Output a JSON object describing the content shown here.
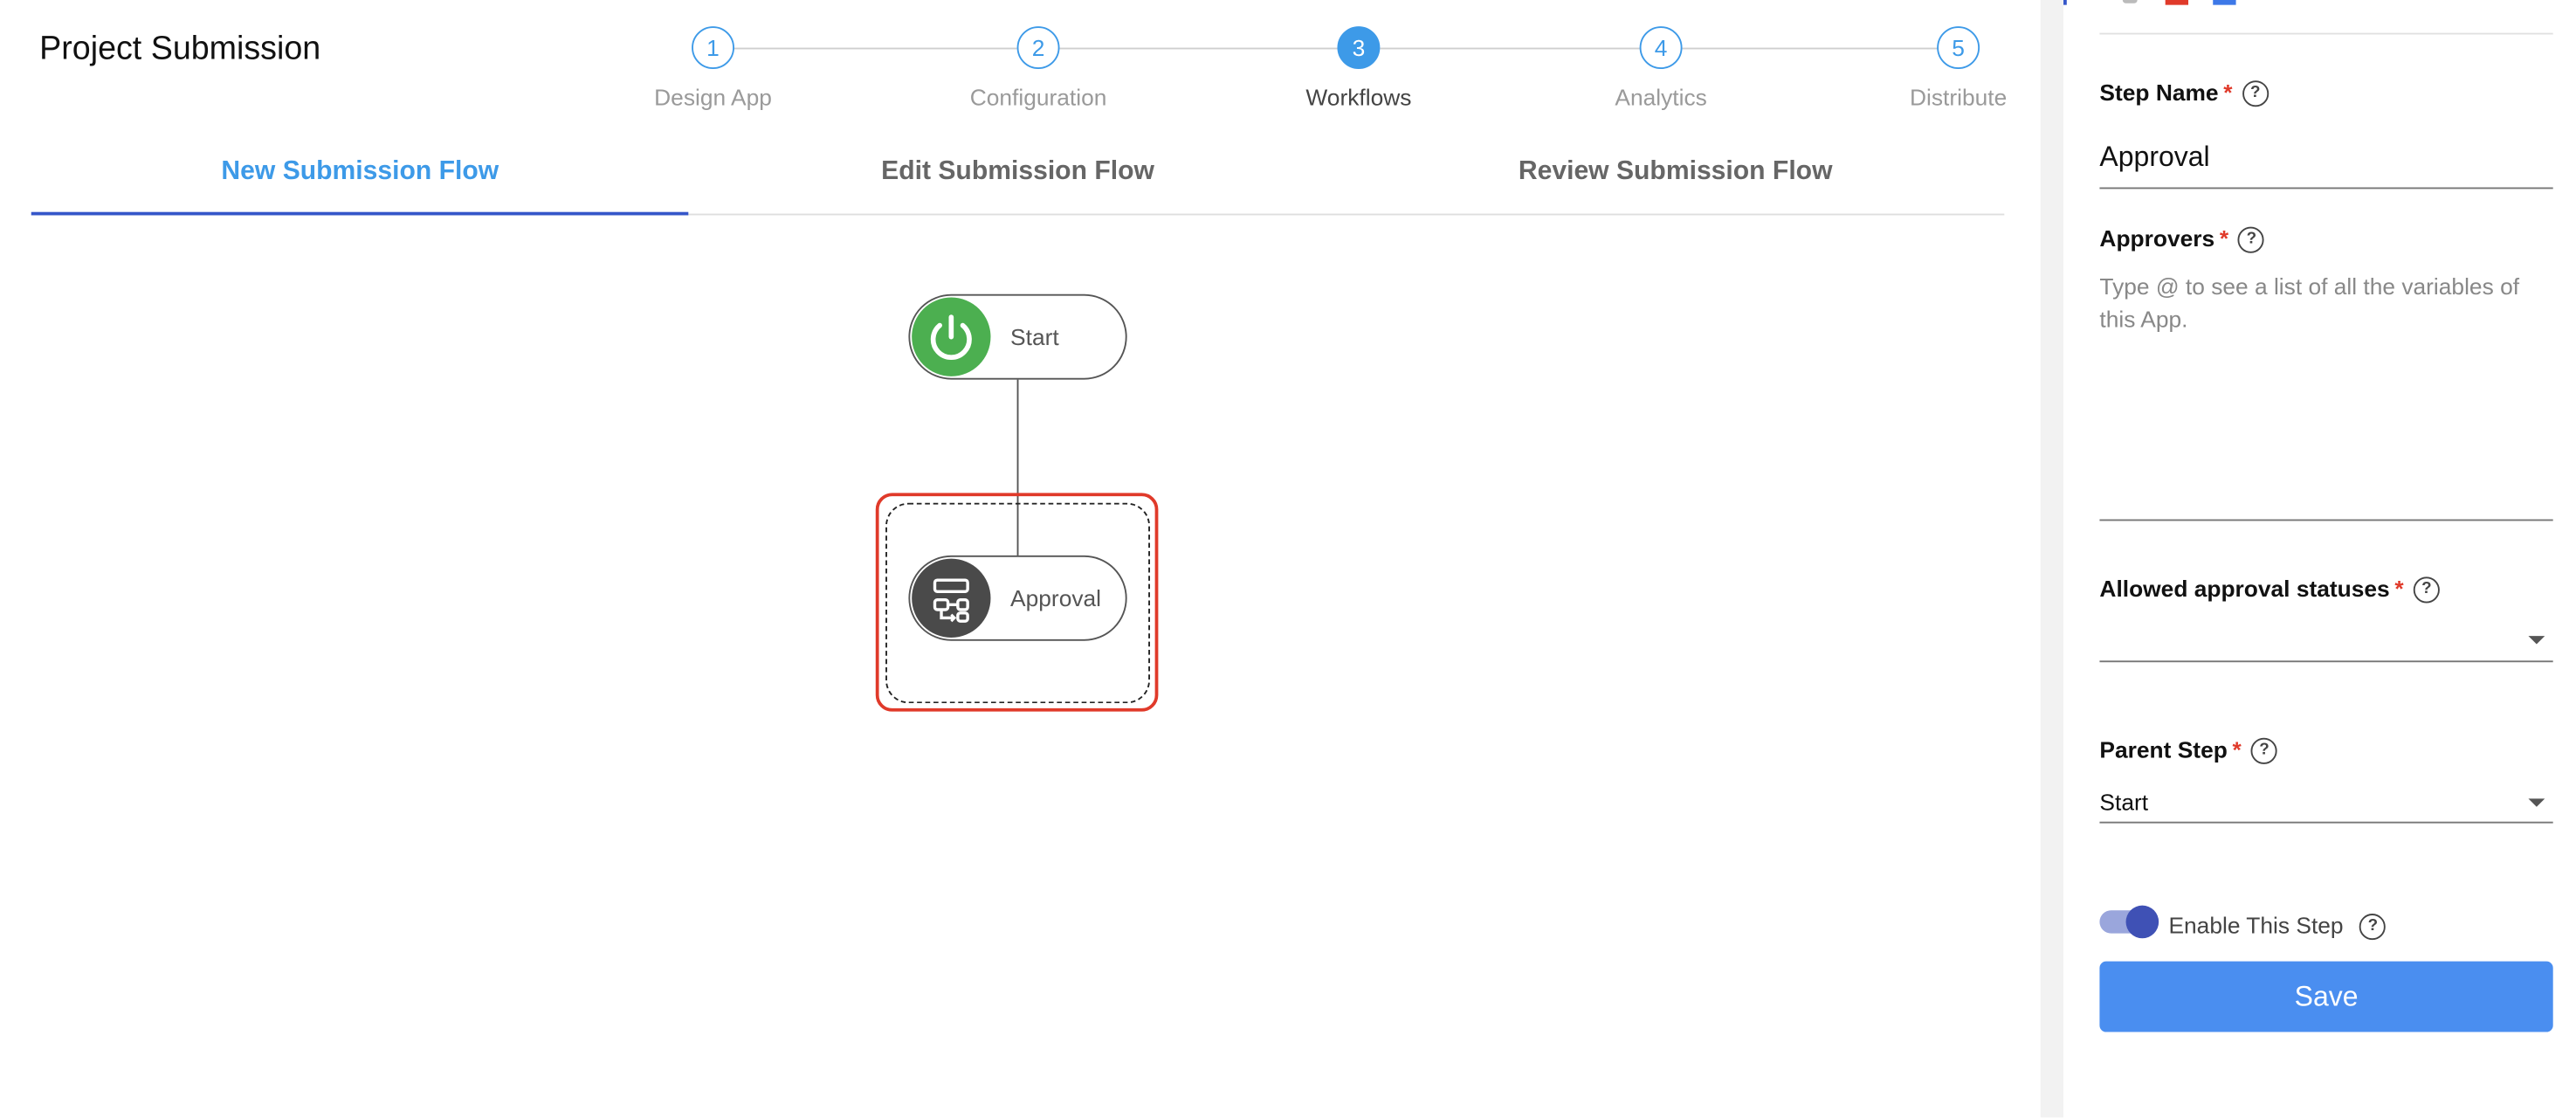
{
  "app": {
    "title": "Project Submission"
  },
  "stepper": {
    "steps": [
      {
        "number": "1",
        "label": "Design App",
        "state": "done"
      },
      {
        "number": "2",
        "label": "Configuration",
        "state": "done"
      },
      {
        "number": "3",
        "label": "Workflows",
        "state": "active"
      },
      {
        "number": "4",
        "label": "Analytics",
        "state": "upcoming"
      },
      {
        "number": "5",
        "label": "Distribute",
        "state": "upcoming"
      }
    ]
  },
  "tabs": [
    {
      "label": "New Submission Flow",
      "active": true
    },
    {
      "label": "Edit Submission Flow",
      "active": false
    },
    {
      "label": "Review Submission Flow",
      "active": false
    }
  ],
  "flow": {
    "nodes": [
      {
        "label": "Start",
        "icon": "power-icon",
        "color": "#4caf50"
      },
      {
        "label": "Approval",
        "icon": "workflow-icon",
        "color": "#4a4a4a",
        "selected": true
      }
    ]
  },
  "panel": {
    "step_name": {
      "label": "Step Name",
      "required": "*",
      "help": "?",
      "value": "Approval"
    },
    "approvers": {
      "label": "Approvers",
      "required": "*",
      "help": "?",
      "placeholder": "Type @ to see a list of all the variables of this App."
    },
    "allowed_statuses": {
      "label": "Allowed approval statuses",
      "required": "*",
      "help": "?",
      "value": ""
    },
    "parent_step": {
      "label": "Parent Step",
      "required": "*",
      "help": "?",
      "value": "Start"
    },
    "enable_step": {
      "label": "Enable This Step",
      "help": "?",
      "enabled": true
    },
    "save_label": "Save"
  },
  "colors": {
    "accent": "#3d9ae8",
    "tab_underline": "#3556c9",
    "selection": "#e03a2a",
    "save": "#4a8ef0",
    "toggle": "#3f51b5"
  }
}
